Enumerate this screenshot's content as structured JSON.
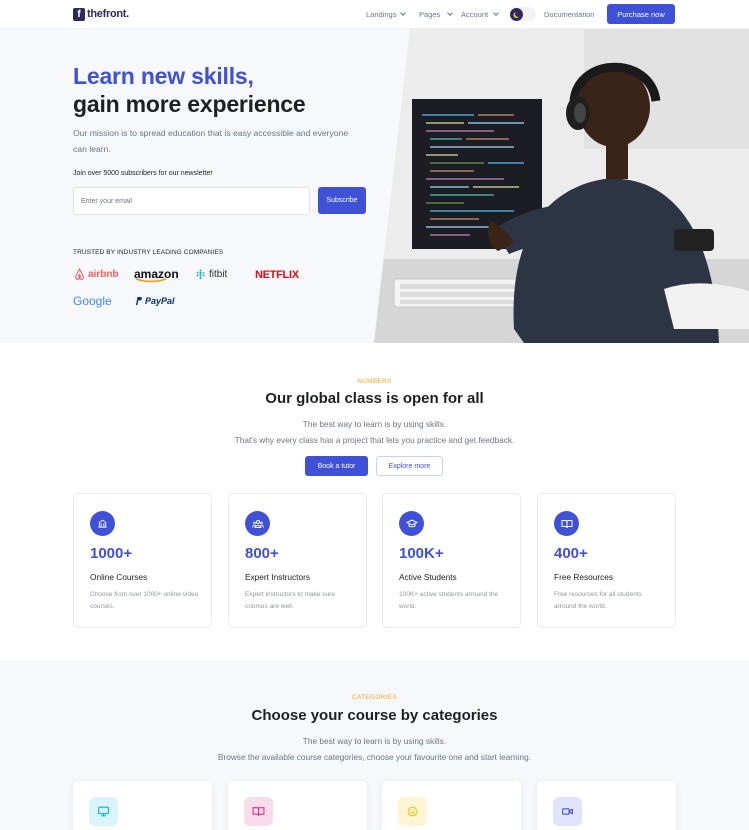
{
  "nav": {
    "logo_mark": "f",
    "logo_text": "thefront.",
    "items": [
      {
        "label": "Landings"
      },
      {
        "label": "Pages"
      },
      {
        "label": "Account"
      }
    ],
    "documentation_label": "Documentation",
    "purchase_label": "Purchase now"
  },
  "hero": {
    "title_line1": "Learn new skills,",
    "title_line2": "gain more experience",
    "subtitle": "Our mission is to spread education that is easy accessible and everyone can learn.",
    "join_text": "Join over 5000 subscribers for our newsletter",
    "email_placeholder": "Enter your email",
    "subscribe_label": "Subscribe",
    "trusted_label": "TRUSTED BY INDUSTRY LEADING COMPANIES",
    "brands": [
      "airbnb",
      "amazon",
      "fitbit",
      "NETFLIX",
      "Google",
      "PayPal"
    ]
  },
  "numbers": {
    "eyebrow": "NUMBERS",
    "title": "Our global class is open for all",
    "subtitle_line1": "The best way to learn is by using skills.",
    "subtitle_line2": "That's why every class has a project that lets you practice and get feedback.",
    "primary_button": "Book a tutor",
    "secondary_button": "Explore more",
    "stats": [
      {
        "value": "1000+",
        "label": "Online Courses",
        "desc": "Choose from over 1000+ online video courses.",
        "icon": "library-icon"
      },
      {
        "value": "800+",
        "label": "Expert Instructors",
        "desc": "Expert instructors to make sure courses are well.",
        "icon": "users-icon"
      },
      {
        "value": "100K+",
        "label": "Active Students",
        "desc": "100K+ active students arround the world.",
        "icon": "graduation-cap-icon"
      },
      {
        "value": "400+",
        "label": "Free Resources",
        "desc": "Free resources for all students arround the world.",
        "icon": "book-open-icon"
      }
    ]
  },
  "categories": {
    "eyebrow": "CATEGORIES",
    "title": "Choose your course by categories",
    "subtitle_line1": "The best way to learn is by using skills.",
    "subtitle_line2": "Browse the available course categories, choose your favourite one and start learning.",
    "cards": [
      {
        "icon": "monitor-icon",
        "color": "#00b4d8"
      },
      {
        "icon": "book-icon",
        "color": "#d63384"
      },
      {
        "icon": "happy-face-icon",
        "color": "#f5c518"
      },
      {
        "icon": "video-camera-icon",
        "color": "#3f51d6"
      }
    ]
  },
  "colors": {
    "primary": "#3f51d6",
    "accent_orange": "#f5a623",
    "dark": "#1e2022",
    "muted": "#677788"
  }
}
